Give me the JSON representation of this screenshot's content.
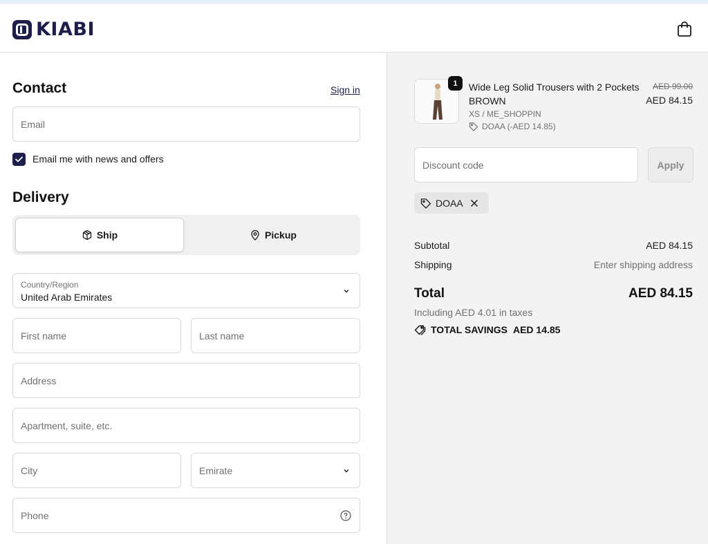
{
  "header": {
    "brand": "KIABI"
  },
  "contact": {
    "title": "Contact",
    "signin_label": "Sign in",
    "email_placeholder": "Email",
    "newsletter_label": "Email me with news and offers",
    "newsletter_checked": true
  },
  "delivery": {
    "title": "Delivery",
    "ship_label": "Ship",
    "pickup_label": "Pickup",
    "selected_method": "Ship",
    "country_label": "Country/Region",
    "country_value": "United Arab Emirates",
    "first_name_placeholder": "First name",
    "last_name_placeholder": "Last name",
    "address_placeholder": "Address",
    "apartment_placeholder": "Apartment, suite, etc.",
    "city_placeholder": "City",
    "emirate_placeholder": "Emirate",
    "phone_placeholder": "Phone"
  },
  "summary": {
    "product": {
      "quantity": "1",
      "name": "Wide Leg Solid Trousers with 2 Pockets BROWN",
      "variant": "XS / ME_SHOPPIN",
      "discount_line": "DOAA (-AED 14.85)",
      "price_original": "AED 99.00",
      "price_final": "AED 84.15"
    },
    "discount_placeholder": "Discount code",
    "apply_label": "Apply",
    "applied_code": "DOAA",
    "subtotal_label": "Subtotal",
    "subtotal_value": "AED 84.15",
    "shipping_label": "Shipping",
    "shipping_value": "Enter shipping address",
    "total_label": "Total",
    "total_value": "AED 84.15",
    "taxes_text": "Including AED 4.01 in taxes",
    "savings_label": "TOTAL SAVINGS",
    "savings_value": "AED 14.85"
  },
  "colors": {
    "brand": "#1d1f4a",
    "summary_bg": "#f3f3f3"
  }
}
